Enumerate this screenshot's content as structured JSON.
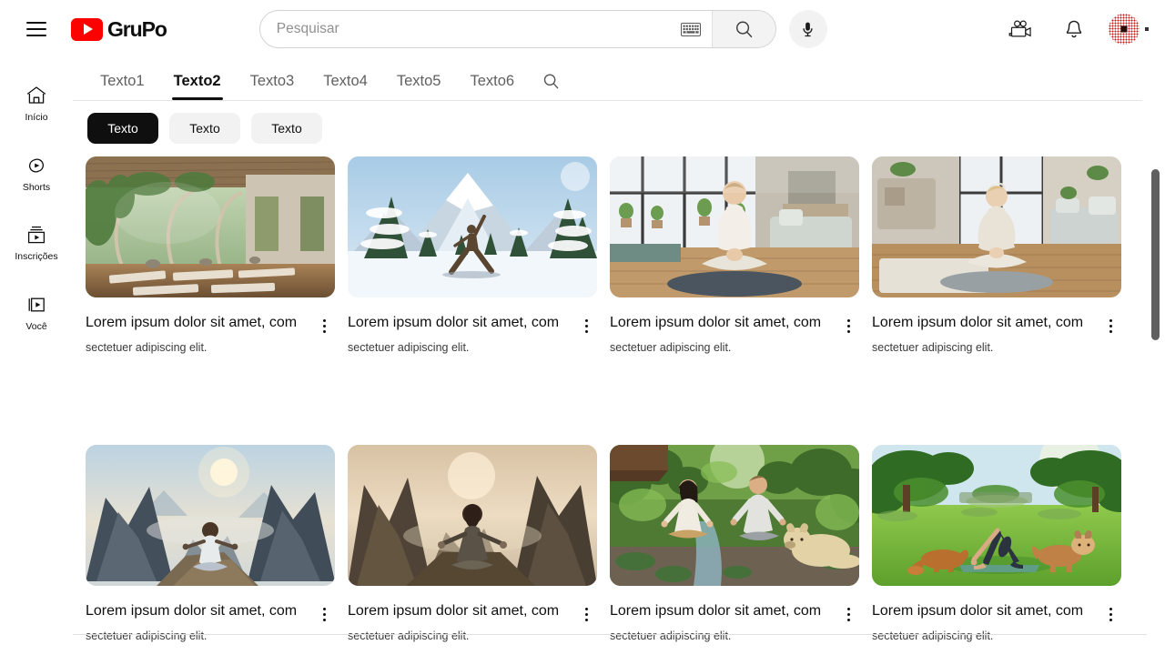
{
  "brand": {
    "wordmark": "GruPo",
    "logo_color": "#ff0000",
    "accent_color": "#0f0f0f"
  },
  "topbar": {
    "menu_icon": "hamburger-menu-icon",
    "search": {
      "placeholder": "Pesquisar",
      "value": "",
      "keyboard_icon": "keyboard-icon",
      "search_icon": "search-icon"
    },
    "mic_icon": "microphone-icon",
    "create_icon": "video-camera-icon",
    "notifications_icon": "bell-icon",
    "avatar_icon": "user-avatar"
  },
  "sidebar": {
    "items": [
      {
        "label": "Início",
        "icon": "home-icon"
      },
      {
        "label": "Shorts",
        "icon": "shorts-icon"
      },
      {
        "label": "Inscrições",
        "icon": "subscriptions-icon"
      },
      {
        "label": "Você",
        "icon": "you-library-icon"
      }
    ]
  },
  "tabs": {
    "items": [
      {
        "label": "Texto1",
        "active": false
      },
      {
        "label": "Texto2",
        "active": true
      },
      {
        "label": "Texto3",
        "active": false
      },
      {
        "label": "Texto4",
        "active": false
      },
      {
        "label": "Texto5",
        "active": false
      },
      {
        "label": "Texto6",
        "active": false
      }
    ],
    "search_icon": "search-icon"
  },
  "chips": [
    {
      "label": "Texto",
      "active": true
    },
    {
      "label": "Texto",
      "active": false
    },
    {
      "label": "Texto",
      "active": false
    }
  ],
  "cards": [
    {
      "title": "Lorem ipsum dolor sit amet, com",
      "subtitle": "sectetuer adipiscing  elit.",
      "thumbnail": "yoga-studio-interior-greenery",
      "menu_icon": "kebab-menu-icon"
    },
    {
      "title": "Lorem ipsum dolor sit amet, com",
      "subtitle": "sectetuer adipiscing  elit.",
      "thumbnail": "snowy-mountain-warrior-pose",
      "menu_icon": "kebab-menu-icon"
    },
    {
      "title": "Lorem ipsum dolor sit amet, com",
      "subtitle": "sectetuer adipiscing  elit.",
      "thumbnail": "indoor-loft-lotus-meditation",
      "menu_icon": "kebab-menu-icon"
    },
    {
      "title": "Lorem ipsum dolor sit amet, com",
      "subtitle": "sectetuer adipiscing  elit.",
      "thumbnail": "living-room-hoodie-meditation",
      "menu_icon": "kebab-menu-icon"
    },
    {
      "title": "Lorem ipsum dolor sit amet, com",
      "subtitle": "sectetuer adipiscing  elit.",
      "thumbnail": "mountain-peak-sunrise-meditation",
      "menu_icon": "kebab-menu-icon"
    },
    {
      "title": "Lorem ipsum dolor sit amet, com",
      "subtitle": "sectetuer adipiscing  elit.",
      "thumbnail": "canyon-sunset-back-meditation",
      "menu_icon": "kebab-menu-icon"
    },
    {
      "title": "Lorem ipsum dolor sit amet, com",
      "subtitle": "sectetuer adipiscing  elit.",
      "thumbnail": "forest-stream-couple-dog-meditation",
      "menu_icon": "kebab-menu-icon"
    },
    {
      "title": "Lorem ipsum dolor sit amet, com",
      "subtitle": "sectetuer adipiscing  elit.",
      "thumbnail": "park-downward-dog-with-dogs",
      "menu_icon": "kebab-menu-icon"
    }
  ]
}
